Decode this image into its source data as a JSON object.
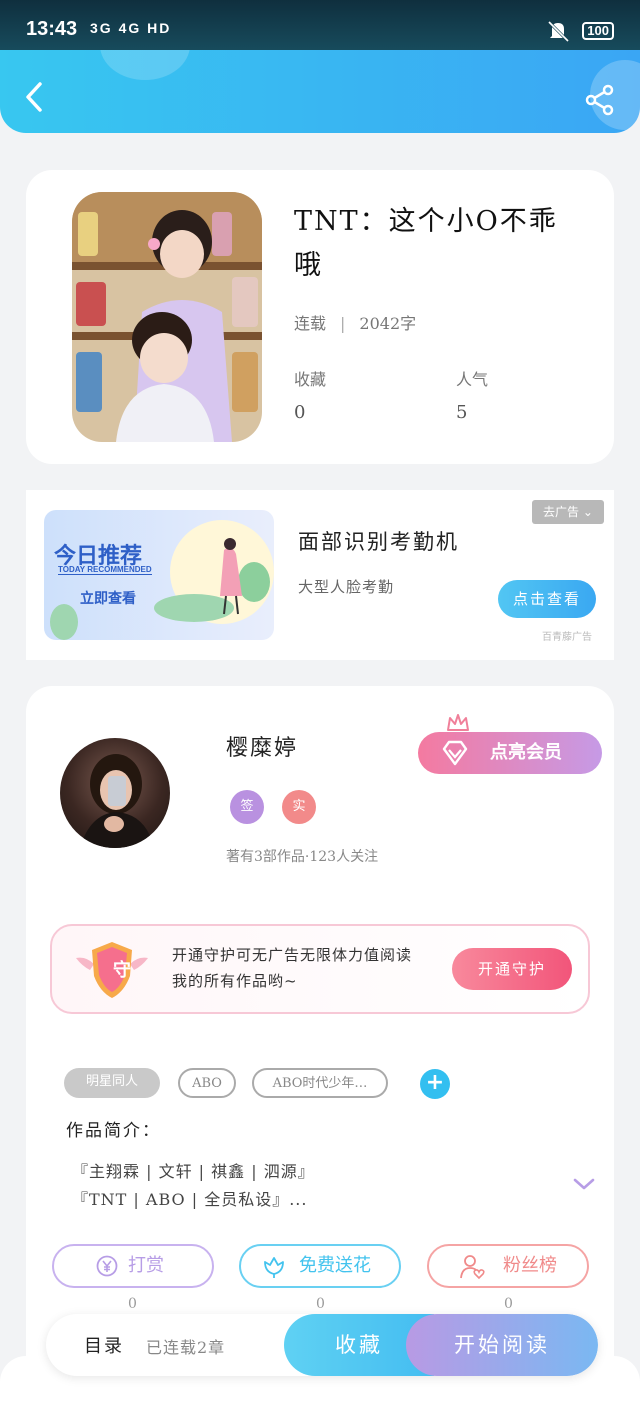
{
  "status_bar": {
    "time": "13:43",
    "signals": "3G 4G HD",
    "battery": "100"
  },
  "book": {
    "title": "TNT：这个小O不乖哦",
    "status": "连载",
    "word_count": "2042字",
    "favorites_label": "收藏",
    "favorites_value": "0",
    "popularity_label": "人气",
    "popularity_value": "5"
  },
  "ad": {
    "image_title": "今日推荐",
    "image_subtitle": "TODAY RECOMMENDED",
    "image_cta": "立即查看",
    "title": "面部识别考勤机",
    "subtitle": "大型人脸考勤",
    "cta": "点击查看",
    "close_label": "去广告",
    "source": "百青藤广告"
  },
  "author": {
    "name": "樱糜婷",
    "badge_signed": "签",
    "badge_verified": "实",
    "stats": "著有3部作品·123人关注",
    "vip_label": "点亮会员"
  },
  "guard": {
    "shield_char": "守",
    "text": "开通守护可无广告无限体力值阅读我的所有作品哟~",
    "button": "开通守护"
  },
  "tags": [
    "明星同人",
    "ABO",
    "ABO时代少年…"
  ],
  "intro": {
    "label": "作品简介：",
    "line1": "『主翔霖 | 文轩 | 祺鑫 | 泗源』",
    "line2": "『TNT | ABO | 全员私设』..."
  },
  "actions": {
    "tip_label": "打赏",
    "tip_count": "0",
    "flower_label": "免费送花",
    "flower_count": "0",
    "fans_label": "粉丝榜",
    "fans_count": "0"
  },
  "bottom_bar": {
    "toc": "目录",
    "chapters": "已连载2章",
    "collect": "收藏",
    "read": "开始阅读"
  },
  "colors": {
    "header_start": "#38c7f0",
    "header_end": "#3aa6f4",
    "tip_accent": "#b79de6",
    "flower_accent": "#43c3ee",
    "fans_accent": "#f08a8a",
    "guard_accent": "#f2557a"
  }
}
